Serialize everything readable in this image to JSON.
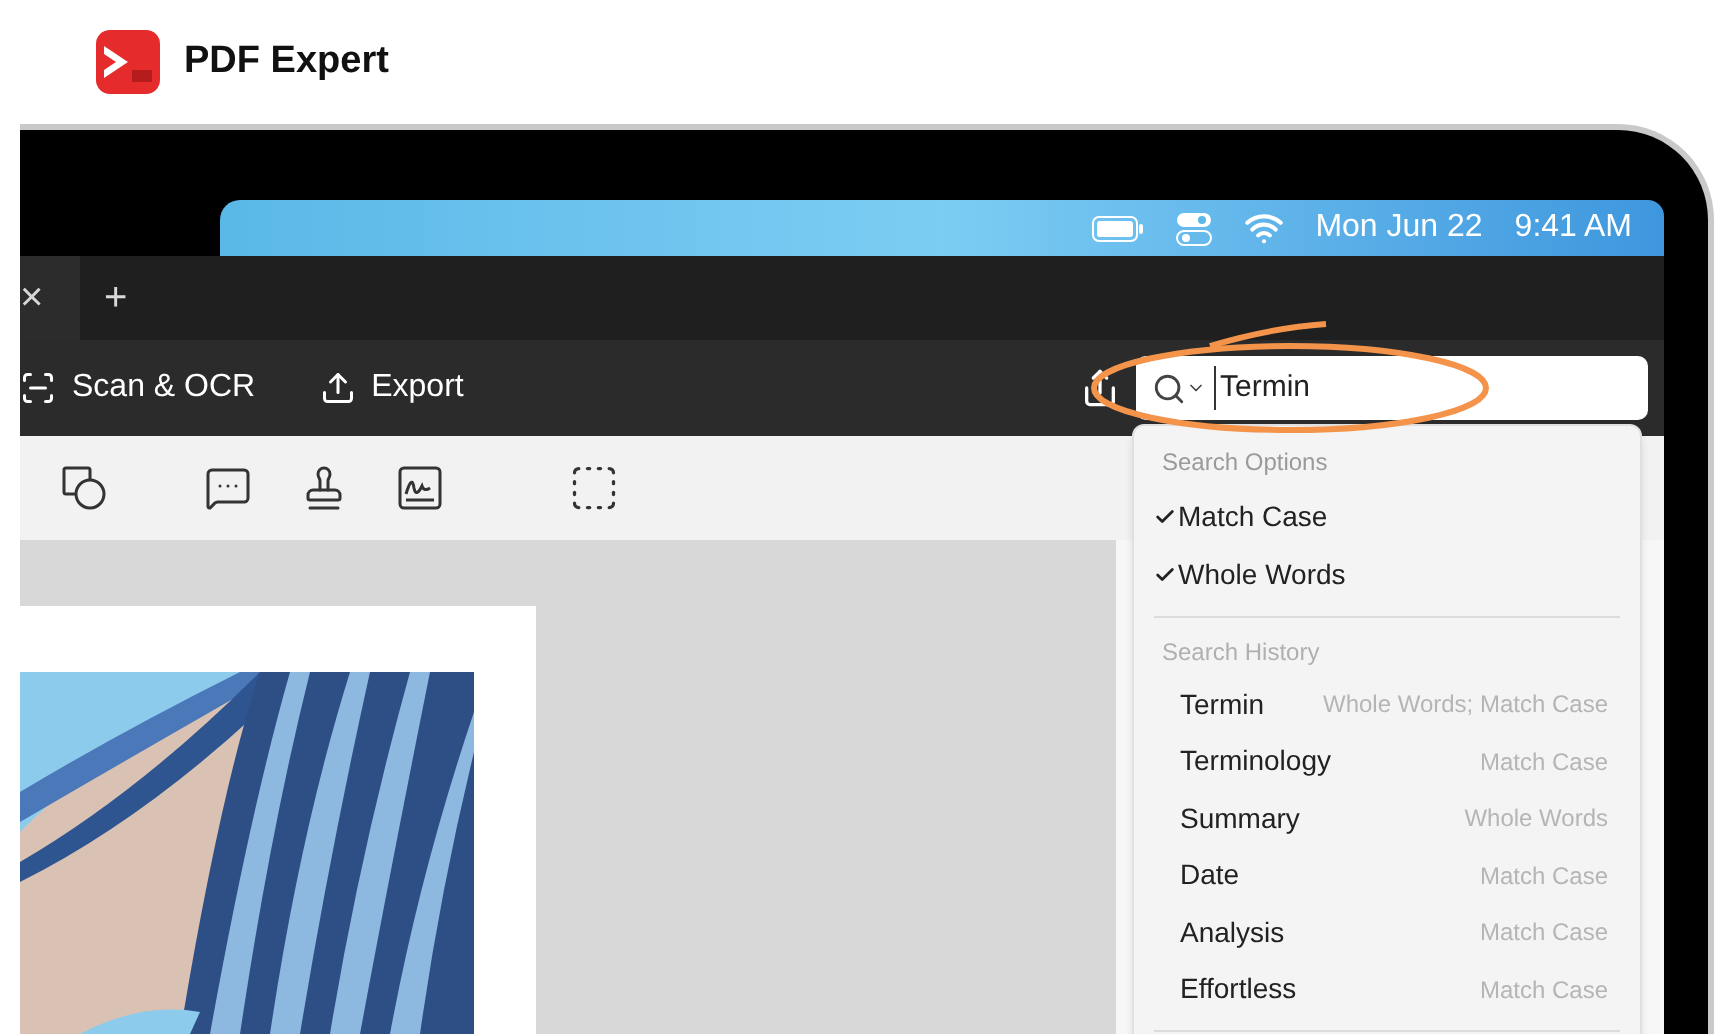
{
  "brand": {
    "name": "PDF Expert"
  },
  "menu_bar": {
    "date": "Mon Jun 22",
    "time": "9:41 AM"
  },
  "tab_bar": {
    "close": "×",
    "add": "+"
  },
  "toolbar": {
    "buttons": [
      {
        "label": "Scan & OCR",
        "kind": "scan"
      },
      {
        "label": "Export",
        "kind": "export"
      }
    ]
  },
  "search": {
    "value": "Termin"
  },
  "search_menu": {
    "options_title": "Search Options",
    "options": [
      {
        "label": "Match Case",
        "checked": true
      },
      {
        "label": "Whole Words",
        "checked": true
      }
    ],
    "history_title": "Search History",
    "history": [
      {
        "term": "Termin",
        "options": "Whole Words; Match Case"
      },
      {
        "term": "Terminology",
        "options": "Match Case"
      },
      {
        "term": "Summary",
        "options": "Whole Words"
      },
      {
        "term": "Date",
        "options": "Match Case"
      },
      {
        "term": "Analysis",
        "options": "Match Case"
      },
      {
        "term": "Effortless",
        "options": "Match Case"
      }
    ]
  }
}
